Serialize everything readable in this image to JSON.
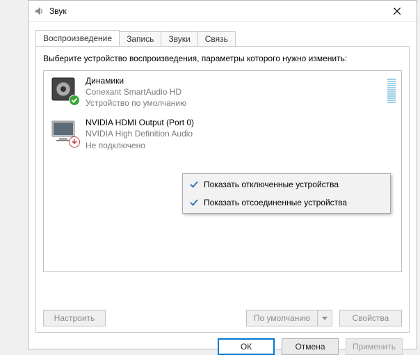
{
  "window": {
    "title": "Звук"
  },
  "tabs": {
    "playback": "Воспроизведение",
    "recording": "Запись",
    "sounds": "Звуки",
    "comm": "Связь"
  },
  "instruction": "Выберите устройство воспроизведения, параметры которого нужно изменить:",
  "devices": [
    {
      "name": "Динамики",
      "subtitle": "Conexant SmartAudio HD",
      "status": "Устройство по умолчанию"
    },
    {
      "name": "NVIDIA HDMI Output (Port 0)",
      "subtitle": "NVIDIA High Definition Audio",
      "status": "Не подключено"
    }
  ],
  "buttons": {
    "configure": "Настроить",
    "default": "По умолчанию",
    "properties": "Свойства",
    "ok": "ОК",
    "cancel": "Отмена",
    "apply": "Применить"
  },
  "context": {
    "show_disabled": "Показать отключенные устройства",
    "show_disconnected": "Показать отсоединенные устройства"
  }
}
